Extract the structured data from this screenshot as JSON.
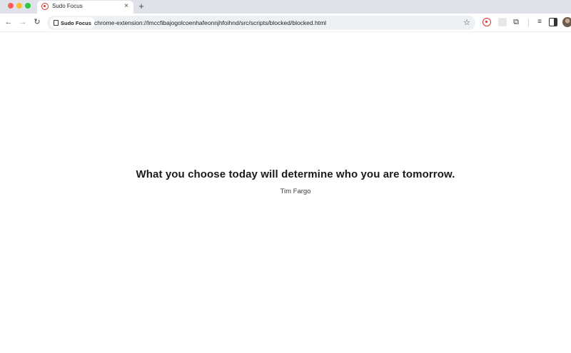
{
  "browser": {
    "tabs": [
      {
        "title": "Sudo Focus",
        "favicon": "sudo-focus-icon",
        "active": true
      }
    ],
    "new_tab_label": "+",
    "tab_close_label": "×",
    "nav": {
      "back": "←",
      "forward": "→",
      "reload": "↻"
    },
    "site_chip_label": "Sudo Focus",
    "url": "chrome-extension://lmccfibajogolcoenhafeonnjhfoihnd/src/scripts/blocked/blocked.html",
    "bookmark_star": "☆",
    "accent_color": "#d9342b"
  },
  "page": {
    "quote": "What you choose today will determine who you are tomorrow.",
    "author": "Tim Fargo"
  }
}
